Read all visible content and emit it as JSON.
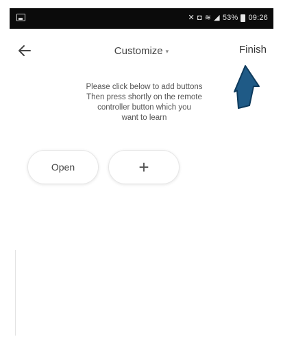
{
  "status_bar": {
    "left_icon": "image-icon",
    "right_icons": [
      "mute-icon",
      "alarm-icon",
      "wifi-icon",
      "signal-icon"
    ],
    "battery_percent": "53%",
    "time": "09:26"
  },
  "nav": {
    "back_icon": "arrow-left-icon",
    "title": "Customize",
    "title_suffix": "▾",
    "finish_label": "Finish"
  },
  "annotation": {
    "arrow_color": "#1f5a86",
    "arrow_icon": "pointer-arrow-icon"
  },
  "instructions": {
    "lines": [
      "Please click below to add buttons",
      "Then press shortly on the remote",
      "controller button which you",
      "want to learn"
    ]
  },
  "buttons": {
    "open_label": "Open",
    "add_label": "+"
  }
}
